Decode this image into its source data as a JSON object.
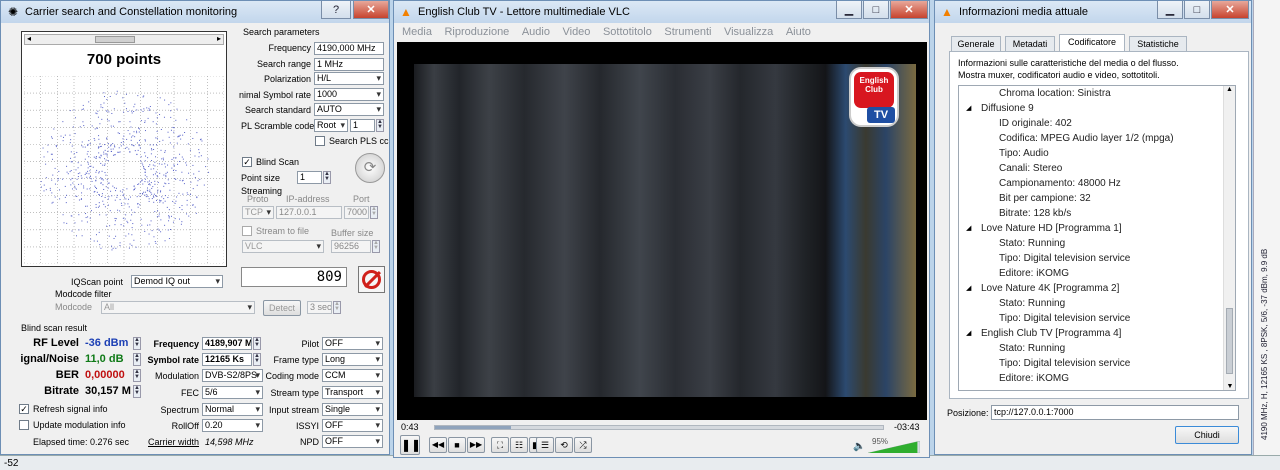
{
  "background": {
    "bottom_value": "-52",
    "right_text": "4190 MHz, H, 12165 KS , 8PSK, 5/6, -37 dBm, 9.9 dB"
  },
  "carrier": {
    "title": "Carrier search and Constellation monitoring",
    "help_btn": "?",
    "close_btn": "✕",
    "points_title": "700 points",
    "search_params_header": "Search parameters",
    "frequency_label": "Frequency",
    "frequency_value": "4190,000 MHz",
    "search_range_label": "Search range",
    "search_range_value": "1 MHz",
    "polarization_label": "Polarization",
    "polarization_value": "H/L",
    "symbol_rate_label": "nimal Symbol rate",
    "symbol_rate_value": "1000",
    "search_standard_label": "Search standard",
    "search_standard_value": "AUTO",
    "pl_scramble_label": "PL Scramble code",
    "pl_scramble_sel": "Root",
    "pl_scramble_value": "1",
    "search_pls_label": "Search PLS cc",
    "blind_scan_label": "Blind Scan",
    "point_size_label": "Point size",
    "point_size_value": "1",
    "streaming_label": "Streaming",
    "proto_label": "Proto",
    "proto_value": "TCP",
    "ip_label": "IP-address",
    "ip_value": "127.0.0.1",
    "port_label": "Port",
    "port_value": "7000",
    "stream_file_label": "Stream to file",
    "buffer_label": "Buffer size",
    "player_value": "VLC",
    "buffer_value": "96256",
    "iqscan_label": "IQScan point",
    "iqscan_value": "Demod IQ out",
    "counter": "809",
    "modcode_filter_label": "Modcode filter",
    "modcode_label": "Modcode",
    "modcode_value": "All",
    "detect_btn": "Detect",
    "detect_time": "3 sec",
    "blind_result_label": "Blind scan result",
    "rf_level_label": "RF Level",
    "rf_level_value": "-36 dBm",
    "snr_label": "ignal/Noise",
    "snr_value": "11,0 dB",
    "ber_label": "BER",
    "ber_value": "0,00000",
    "bitrate_label": "Bitrate",
    "bitrate_value": "30,157 M",
    "frequency2_label": "Frequency",
    "frequency2_value": "4189,907 M",
    "symrate_label": "Symbol rate",
    "symrate_value": "12165 Ks",
    "modulation_label": "Modulation",
    "modulation_value": "DVB-S2/8PS",
    "fec_label": "FEC",
    "fec_value": "5/6",
    "spectrum_label": "Spectrum",
    "spectrum_value": "Normal",
    "rolloff_label": "RollOff",
    "rolloff_value": "0.20",
    "carrier_width_label": "Carrier width",
    "carrier_width_value": "14,598 MHz",
    "pilot_label": "Pilot",
    "pilot_value": "OFF",
    "frame_type_label": "Frame type",
    "frame_type_value": "Long",
    "coding_mode_label": "Coding mode",
    "coding_mode_value": "CCM",
    "stream_type_label": "Stream type",
    "stream_type_value": "Transport",
    "input_stream_label": "Input stream",
    "input_stream_value": "Single",
    "issyi_label": "ISSYI",
    "issyi_value": "OFF",
    "npd_label": "NPD",
    "npd_value": "OFF",
    "refresh_label": "Refresh signal info",
    "update_mod_label": "Update modulation info",
    "elapsed_label": "Elapsed time: 0.276 sec"
  },
  "vlc": {
    "title": "English Club TV - Lettore multimediale VLC",
    "menu": [
      "Media",
      "Riproduzione",
      "Audio",
      "Video",
      "Sottotitolo",
      "Strumenti",
      "Visualizza",
      "Aiuto"
    ],
    "logo_line1": "English",
    "logo_line2": "Club",
    "logo_line3": "TV",
    "time_elapsed": "0:43",
    "time_remaining": "-03:43",
    "progress": 0.17,
    "volume_label": "95%",
    "volume": 0.95
  },
  "info": {
    "title": "Informazioni media attuale",
    "tabs": [
      "Generale",
      "Metadati",
      "Codificatore",
      "Statistiche"
    ],
    "description_line1": "Informazioni sulle caratteristiche del media o del flusso.",
    "description_line2": "Mostra muxer, codificatori audio e video, sottotitoli.",
    "tree": [
      "Chroma location: Sinistra",
      "Diffusione 9",
      "ID originale: 402",
      "Codifica: MPEG Audio layer 1/2 (mpga)",
      "Tipo: Audio",
      "Canali: Stereo",
      "Campionamento: 48000 Hz",
      "Bit per campione: 32",
      "Bitrate: 128 kb/s",
      "Love Nature HD [Programma 1]",
      "Stato: Running",
      "Tipo: Digital television service",
      "Editore: iKOMG",
      "Love Nature 4K [Programma 2]",
      "Stato: Running",
      "Tipo: Digital television service",
      "English Club TV [Programma 4]",
      "Stato: Running",
      "Tipo: Digital television service",
      "Editore: iKOMG"
    ],
    "position_label": "Posizione:",
    "position_value": "tcp://127.0.0.1:7000",
    "close_btn": "Chiudi"
  }
}
